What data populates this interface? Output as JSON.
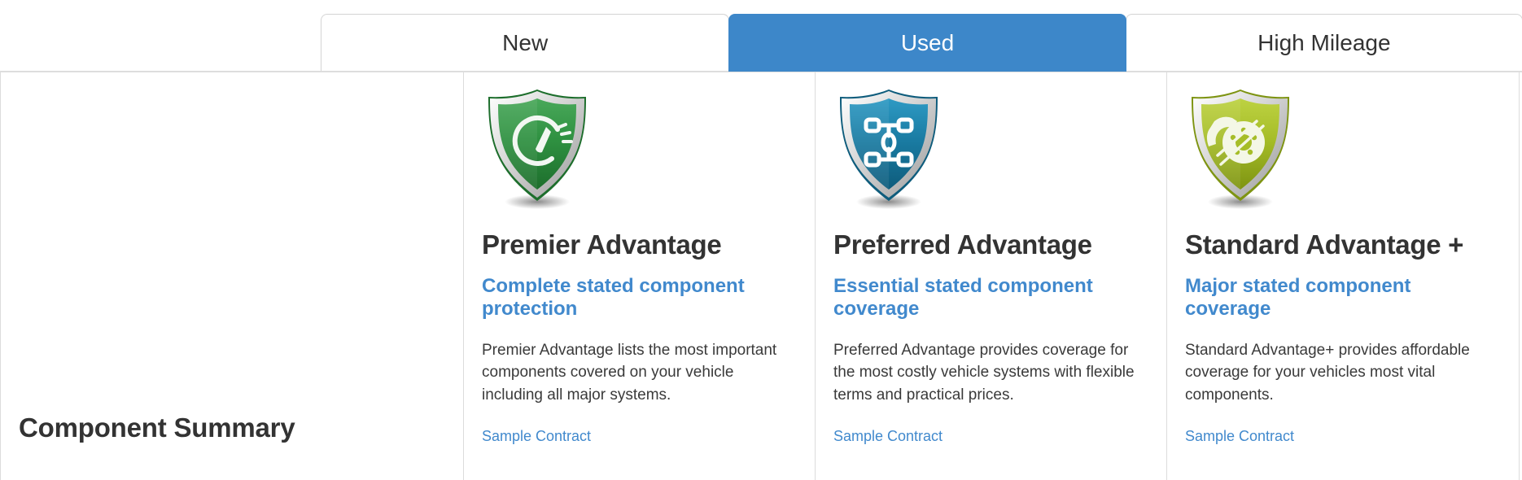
{
  "tabs": [
    {
      "label": "New",
      "active": false,
      "name": "tab-new"
    },
    {
      "label": "Used",
      "active": true,
      "name": "tab-used"
    },
    {
      "label": "High Mileage",
      "active": false,
      "name": "tab-high-mileage"
    }
  ],
  "summary": {
    "title": "Component Summary"
  },
  "colors": {
    "active_tab": "#3d87c9",
    "link": "#4189cd",
    "text": "#333333",
    "border": "#dcdcdc",
    "shield_premier": "#2f9141",
    "shield_preferred": "#1a7ca3",
    "shield_standard": "#a6bd28"
  },
  "plans": [
    {
      "icon": "shield-speedometer-icon",
      "accent": "#2f9141",
      "name": "Premier Advantage",
      "tagline": "Complete stated component protection",
      "description": "Premier Advantage lists the most important components covered on your vehicle including all major systems.",
      "link_label": "Sample Contract"
    },
    {
      "icon": "shield-drivetrain-icon",
      "accent": "#1a7ca3",
      "name": "Preferred Advantage",
      "tagline": "Essential stated component coverage",
      "description": "Preferred Advantage provides coverage for the most costly vehicle systems with flexible terms and practical prices.",
      "link_label": "Sample Contract"
    },
    {
      "icon": "shield-brake-rotor-icon",
      "accent": "#a6bd28",
      "name": "Standard Advantage +",
      "tagline": "Major stated component coverage",
      "description": "Standard Advantage+ provides affordable coverage for your vehicles most vital components.",
      "link_label": "Sample Contract"
    }
  ]
}
